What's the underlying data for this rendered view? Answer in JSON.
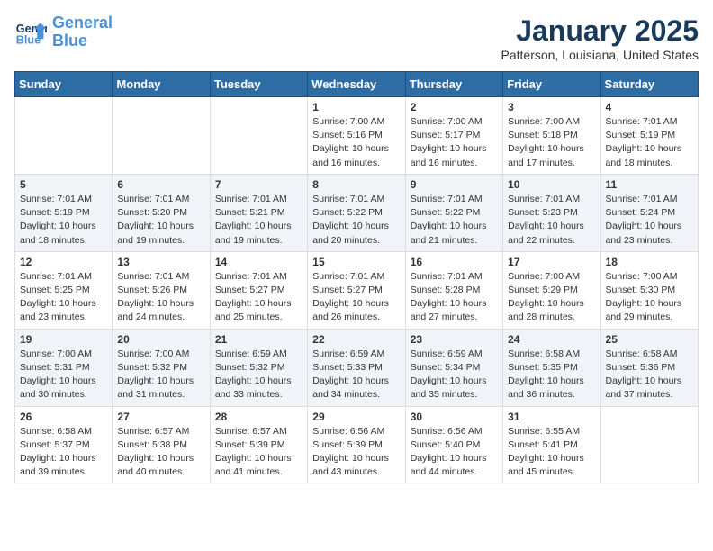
{
  "header": {
    "logo_line1": "General",
    "logo_line2": "Blue",
    "month": "January 2025",
    "location": "Patterson, Louisiana, United States"
  },
  "weekdays": [
    "Sunday",
    "Monday",
    "Tuesday",
    "Wednesday",
    "Thursday",
    "Friday",
    "Saturday"
  ],
  "weeks": [
    [
      {
        "day": "",
        "info": ""
      },
      {
        "day": "",
        "info": ""
      },
      {
        "day": "",
        "info": ""
      },
      {
        "day": "1",
        "info": "Sunrise: 7:00 AM\nSunset: 5:16 PM\nDaylight: 10 hours\nand 16 minutes."
      },
      {
        "day": "2",
        "info": "Sunrise: 7:00 AM\nSunset: 5:17 PM\nDaylight: 10 hours\nand 16 minutes."
      },
      {
        "day": "3",
        "info": "Sunrise: 7:00 AM\nSunset: 5:18 PM\nDaylight: 10 hours\nand 17 minutes."
      },
      {
        "day": "4",
        "info": "Sunrise: 7:01 AM\nSunset: 5:19 PM\nDaylight: 10 hours\nand 18 minutes."
      }
    ],
    [
      {
        "day": "5",
        "info": "Sunrise: 7:01 AM\nSunset: 5:19 PM\nDaylight: 10 hours\nand 18 minutes."
      },
      {
        "day": "6",
        "info": "Sunrise: 7:01 AM\nSunset: 5:20 PM\nDaylight: 10 hours\nand 19 minutes."
      },
      {
        "day": "7",
        "info": "Sunrise: 7:01 AM\nSunset: 5:21 PM\nDaylight: 10 hours\nand 19 minutes."
      },
      {
        "day": "8",
        "info": "Sunrise: 7:01 AM\nSunset: 5:22 PM\nDaylight: 10 hours\nand 20 minutes."
      },
      {
        "day": "9",
        "info": "Sunrise: 7:01 AM\nSunset: 5:22 PM\nDaylight: 10 hours\nand 21 minutes."
      },
      {
        "day": "10",
        "info": "Sunrise: 7:01 AM\nSunset: 5:23 PM\nDaylight: 10 hours\nand 22 minutes."
      },
      {
        "day": "11",
        "info": "Sunrise: 7:01 AM\nSunset: 5:24 PM\nDaylight: 10 hours\nand 23 minutes."
      }
    ],
    [
      {
        "day": "12",
        "info": "Sunrise: 7:01 AM\nSunset: 5:25 PM\nDaylight: 10 hours\nand 23 minutes."
      },
      {
        "day": "13",
        "info": "Sunrise: 7:01 AM\nSunset: 5:26 PM\nDaylight: 10 hours\nand 24 minutes."
      },
      {
        "day": "14",
        "info": "Sunrise: 7:01 AM\nSunset: 5:27 PM\nDaylight: 10 hours\nand 25 minutes."
      },
      {
        "day": "15",
        "info": "Sunrise: 7:01 AM\nSunset: 5:27 PM\nDaylight: 10 hours\nand 26 minutes."
      },
      {
        "day": "16",
        "info": "Sunrise: 7:01 AM\nSunset: 5:28 PM\nDaylight: 10 hours\nand 27 minutes."
      },
      {
        "day": "17",
        "info": "Sunrise: 7:00 AM\nSunset: 5:29 PM\nDaylight: 10 hours\nand 28 minutes."
      },
      {
        "day": "18",
        "info": "Sunrise: 7:00 AM\nSunset: 5:30 PM\nDaylight: 10 hours\nand 29 minutes."
      }
    ],
    [
      {
        "day": "19",
        "info": "Sunrise: 7:00 AM\nSunset: 5:31 PM\nDaylight: 10 hours\nand 30 minutes."
      },
      {
        "day": "20",
        "info": "Sunrise: 7:00 AM\nSunset: 5:32 PM\nDaylight: 10 hours\nand 31 minutes."
      },
      {
        "day": "21",
        "info": "Sunrise: 6:59 AM\nSunset: 5:32 PM\nDaylight: 10 hours\nand 33 minutes."
      },
      {
        "day": "22",
        "info": "Sunrise: 6:59 AM\nSunset: 5:33 PM\nDaylight: 10 hours\nand 34 minutes."
      },
      {
        "day": "23",
        "info": "Sunrise: 6:59 AM\nSunset: 5:34 PM\nDaylight: 10 hours\nand 35 minutes."
      },
      {
        "day": "24",
        "info": "Sunrise: 6:58 AM\nSunset: 5:35 PM\nDaylight: 10 hours\nand 36 minutes."
      },
      {
        "day": "25",
        "info": "Sunrise: 6:58 AM\nSunset: 5:36 PM\nDaylight: 10 hours\nand 37 minutes."
      }
    ],
    [
      {
        "day": "26",
        "info": "Sunrise: 6:58 AM\nSunset: 5:37 PM\nDaylight: 10 hours\nand 39 minutes."
      },
      {
        "day": "27",
        "info": "Sunrise: 6:57 AM\nSunset: 5:38 PM\nDaylight: 10 hours\nand 40 minutes."
      },
      {
        "day": "28",
        "info": "Sunrise: 6:57 AM\nSunset: 5:39 PM\nDaylight: 10 hours\nand 41 minutes."
      },
      {
        "day": "29",
        "info": "Sunrise: 6:56 AM\nSunset: 5:39 PM\nDaylight: 10 hours\nand 43 minutes."
      },
      {
        "day": "30",
        "info": "Sunrise: 6:56 AM\nSunset: 5:40 PM\nDaylight: 10 hours\nand 44 minutes."
      },
      {
        "day": "31",
        "info": "Sunrise: 6:55 AM\nSunset: 5:41 PM\nDaylight: 10 hours\nand 45 minutes."
      },
      {
        "day": "",
        "info": ""
      }
    ]
  ]
}
